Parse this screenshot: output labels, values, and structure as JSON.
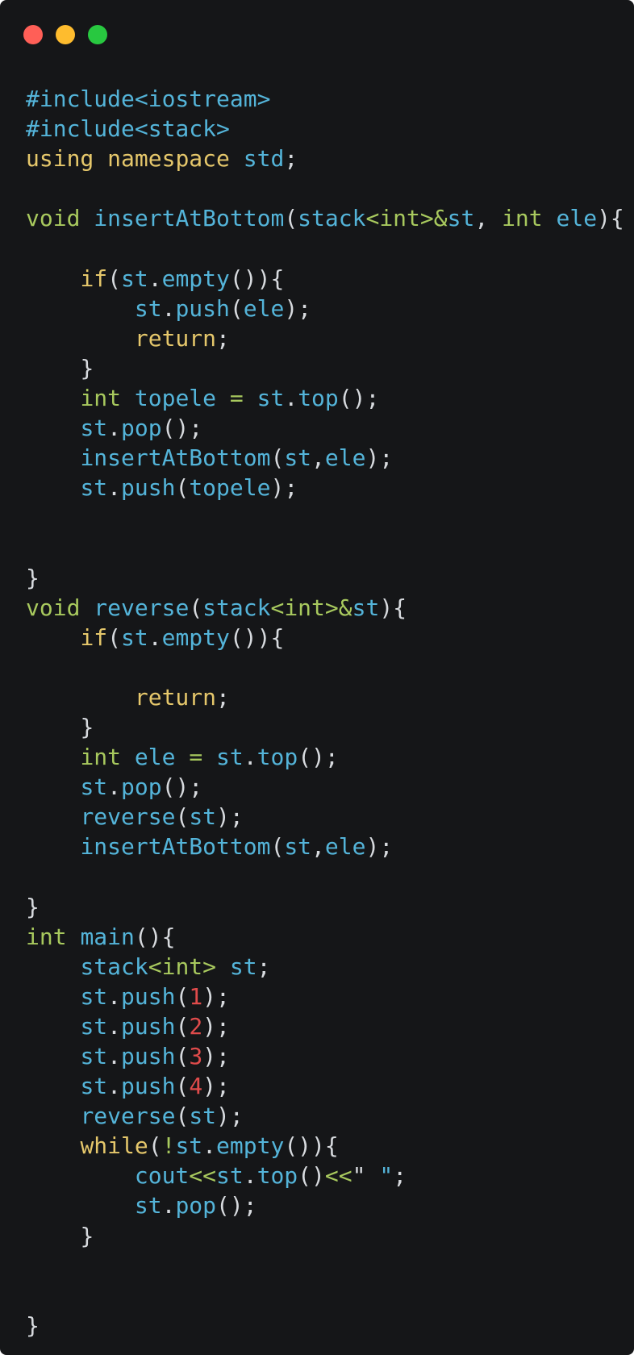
{
  "window": {
    "controls": [
      {
        "name": "close-button",
        "color": "#ff5f57"
      },
      {
        "name": "minimize-button",
        "color": "#febc2e"
      },
      {
        "name": "zoom-button",
        "color": "#28c840"
      }
    ]
  },
  "colors": {
    "pp": "#54b4d9",
    "kw": "#e5c76b",
    "ty": "#a8c95e",
    "fn": "#54b4d9",
    "id": "#54b4d9",
    "pu": "#d7dade",
    "nu": "#e04b4b",
    "st": "#54b4d9",
    "sp": "#d7dade"
  },
  "code_lines": [
    [
      [
        "#include<iostream>",
        "pp"
      ]
    ],
    [
      [
        "#include<stack>",
        "pp"
      ]
    ],
    [
      [
        "using",
        "kw"
      ],
      [
        " ",
        "sp"
      ],
      [
        "namespace",
        "kw"
      ],
      [
        " ",
        "sp"
      ],
      [
        "std",
        "id"
      ],
      [
        ";",
        "pu"
      ]
    ],
    [],
    [
      [
        "void",
        "ty"
      ],
      [
        " ",
        "sp"
      ],
      [
        "insertAtBottom",
        "fn"
      ],
      [
        "(",
        "pu"
      ],
      [
        "stack",
        "id"
      ],
      [
        "<",
        "ty"
      ],
      [
        "int",
        "ty"
      ],
      [
        ">",
        "ty"
      ],
      [
        "&",
        "ty"
      ],
      [
        "st",
        "id"
      ],
      [
        ", ",
        "pu"
      ],
      [
        "int",
        "ty"
      ],
      [
        " ",
        "sp"
      ],
      [
        "ele",
        "id"
      ],
      [
        "){",
        "pu"
      ]
    ],
    [],
    [
      [
        "    ",
        "sp"
      ],
      [
        "if",
        "kw"
      ],
      [
        "(",
        "pu"
      ],
      [
        "st",
        "id"
      ],
      [
        ".",
        "pu"
      ],
      [
        "empty",
        "fn"
      ],
      [
        "()){",
        "pu"
      ]
    ],
    [
      [
        "        ",
        "sp"
      ],
      [
        "st",
        "id"
      ],
      [
        ".",
        "pu"
      ],
      [
        "push",
        "fn"
      ],
      [
        "(",
        "pu"
      ],
      [
        "ele",
        "id"
      ],
      [
        ");",
        "pu"
      ]
    ],
    [
      [
        "        ",
        "sp"
      ],
      [
        "return",
        "kw"
      ],
      [
        ";",
        "pu"
      ]
    ],
    [
      [
        "    ",
        "sp"
      ],
      [
        "}",
        "pu"
      ]
    ],
    [
      [
        "    ",
        "sp"
      ],
      [
        "int",
        "ty"
      ],
      [
        " ",
        "sp"
      ],
      [
        "topele",
        "id"
      ],
      [
        " ",
        "sp"
      ],
      [
        "=",
        "ty"
      ],
      [
        " ",
        "sp"
      ],
      [
        "st",
        "id"
      ],
      [
        ".",
        "pu"
      ],
      [
        "top",
        "fn"
      ],
      [
        "();",
        "pu"
      ]
    ],
    [
      [
        "    ",
        "sp"
      ],
      [
        "st",
        "id"
      ],
      [
        ".",
        "pu"
      ],
      [
        "pop",
        "fn"
      ],
      [
        "();",
        "pu"
      ]
    ],
    [
      [
        "    ",
        "sp"
      ],
      [
        "insertAtBottom",
        "fn"
      ],
      [
        "(",
        "pu"
      ],
      [
        "st",
        "id"
      ],
      [
        ",",
        "pu"
      ],
      [
        "ele",
        "id"
      ],
      [
        ");",
        "pu"
      ]
    ],
    [
      [
        "    ",
        "sp"
      ],
      [
        "st",
        "id"
      ],
      [
        ".",
        "pu"
      ],
      [
        "push",
        "fn"
      ],
      [
        "(",
        "pu"
      ],
      [
        "topele",
        "id"
      ],
      [
        ");",
        "pu"
      ]
    ],
    [],
    [],
    [
      [
        "}",
        "pu"
      ]
    ],
    [
      [
        "void",
        "ty"
      ],
      [
        " ",
        "sp"
      ],
      [
        "reverse",
        "fn"
      ],
      [
        "(",
        "pu"
      ],
      [
        "stack",
        "id"
      ],
      [
        "<",
        "ty"
      ],
      [
        "int",
        "ty"
      ],
      [
        ">",
        "ty"
      ],
      [
        "&",
        "ty"
      ],
      [
        "st",
        "id"
      ],
      [
        "){",
        "pu"
      ]
    ],
    [
      [
        "    ",
        "sp"
      ],
      [
        "if",
        "kw"
      ],
      [
        "(",
        "pu"
      ],
      [
        "st",
        "id"
      ],
      [
        ".",
        "pu"
      ],
      [
        "empty",
        "fn"
      ],
      [
        "()){",
        "pu"
      ]
    ],
    [],
    [
      [
        "        ",
        "sp"
      ],
      [
        "return",
        "kw"
      ],
      [
        ";",
        "pu"
      ]
    ],
    [
      [
        "    ",
        "sp"
      ],
      [
        "}",
        "pu"
      ]
    ],
    [
      [
        "    ",
        "sp"
      ],
      [
        "int",
        "ty"
      ],
      [
        " ",
        "sp"
      ],
      [
        "ele",
        "id"
      ],
      [
        " ",
        "sp"
      ],
      [
        "=",
        "ty"
      ],
      [
        " ",
        "sp"
      ],
      [
        "st",
        "id"
      ],
      [
        ".",
        "pu"
      ],
      [
        "top",
        "fn"
      ],
      [
        "();",
        "pu"
      ]
    ],
    [
      [
        "    ",
        "sp"
      ],
      [
        "st",
        "id"
      ],
      [
        ".",
        "pu"
      ],
      [
        "pop",
        "fn"
      ],
      [
        "();",
        "pu"
      ]
    ],
    [
      [
        "    ",
        "sp"
      ],
      [
        "reverse",
        "fn"
      ],
      [
        "(",
        "pu"
      ],
      [
        "st",
        "id"
      ],
      [
        ");",
        "pu"
      ]
    ],
    [
      [
        "    ",
        "sp"
      ],
      [
        "insertAtBottom",
        "fn"
      ],
      [
        "(",
        "pu"
      ],
      [
        "st",
        "id"
      ],
      [
        ",",
        "pu"
      ],
      [
        "ele",
        "id"
      ],
      [
        ");",
        "pu"
      ]
    ],
    [],
    [
      [
        "}",
        "pu"
      ]
    ],
    [
      [
        "int",
        "ty"
      ],
      [
        " ",
        "sp"
      ],
      [
        "main",
        "fn"
      ],
      [
        "(){",
        "pu"
      ]
    ],
    [
      [
        "    ",
        "sp"
      ],
      [
        "stack",
        "id"
      ],
      [
        "<",
        "ty"
      ],
      [
        "int",
        "ty"
      ],
      [
        ">",
        "ty"
      ],
      [
        " ",
        "sp"
      ],
      [
        "st",
        "id"
      ],
      [
        ";",
        "pu"
      ]
    ],
    [
      [
        "    ",
        "sp"
      ],
      [
        "st",
        "id"
      ],
      [
        ".",
        "pu"
      ],
      [
        "push",
        "fn"
      ],
      [
        "(",
        "pu"
      ],
      [
        "1",
        "nu"
      ],
      [
        ");",
        "pu"
      ]
    ],
    [
      [
        "    ",
        "sp"
      ],
      [
        "st",
        "id"
      ],
      [
        ".",
        "pu"
      ],
      [
        "push",
        "fn"
      ],
      [
        "(",
        "pu"
      ],
      [
        "2",
        "nu"
      ],
      [
        ");",
        "pu"
      ]
    ],
    [
      [
        "    ",
        "sp"
      ],
      [
        "st",
        "id"
      ],
      [
        ".",
        "pu"
      ],
      [
        "push",
        "fn"
      ],
      [
        "(",
        "pu"
      ],
      [
        "3",
        "nu"
      ],
      [
        ");",
        "pu"
      ]
    ],
    [
      [
        "    ",
        "sp"
      ],
      [
        "st",
        "id"
      ],
      [
        ".",
        "pu"
      ],
      [
        "push",
        "fn"
      ],
      [
        "(",
        "pu"
      ],
      [
        "4",
        "nu"
      ],
      [
        ");",
        "pu"
      ]
    ],
    [
      [
        "    ",
        "sp"
      ],
      [
        "reverse",
        "fn"
      ],
      [
        "(",
        "pu"
      ],
      [
        "st",
        "id"
      ],
      [
        ");",
        "pu"
      ]
    ],
    [
      [
        "    ",
        "sp"
      ],
      [
        "while",
        "kw"
      ],
      [
        "(",
        "pu"
      ],
      [
        "!",
        "ty"
      ],
      [
        "st",
        "id"
      ],
      [
        ".",
        "pu"
      ],
      [
        "empty",
        "fn"
      ],
      [
        "()){",
        "pu"
      ]
    ],
    [
      [
        "        ",
        "sp"
      ],
      [
        "cout",
        "id"
      ],
      [
        "<<",
        "ty"
      ],
      [
        "st",
        "id"
      ],
      [
        ".",
        "pu"
      ],
      [
        "top",
        "fn"
      ],
      [
        "()",
        "pu"
      ],
      [
        "<<",
        "ty"
      ],
      [
        "\"",
        "pu"
      ],
      [
        " ",
        "sp"
      ],
      [
        "\"",
        "st"
      ],
      [
        ";",
        "pu"
      ]
    ],
    [
      [
        "        ",
        "sp"
      ],
      [
        "st",
        "id"
      ],
      [
        ".",
        "pu"
      ],
      [
        "pop",
        "fn"
      ],
      [
        "();",
        "pu"
      ]
    ],
    [
      [
        "    ",
        "sp"
      ],
      [
        "}",
        "pu"
      ]
    ],
    [],
    [],
    [
      [
        "}",
        "pu"
      ]
    ]
  ]
}
